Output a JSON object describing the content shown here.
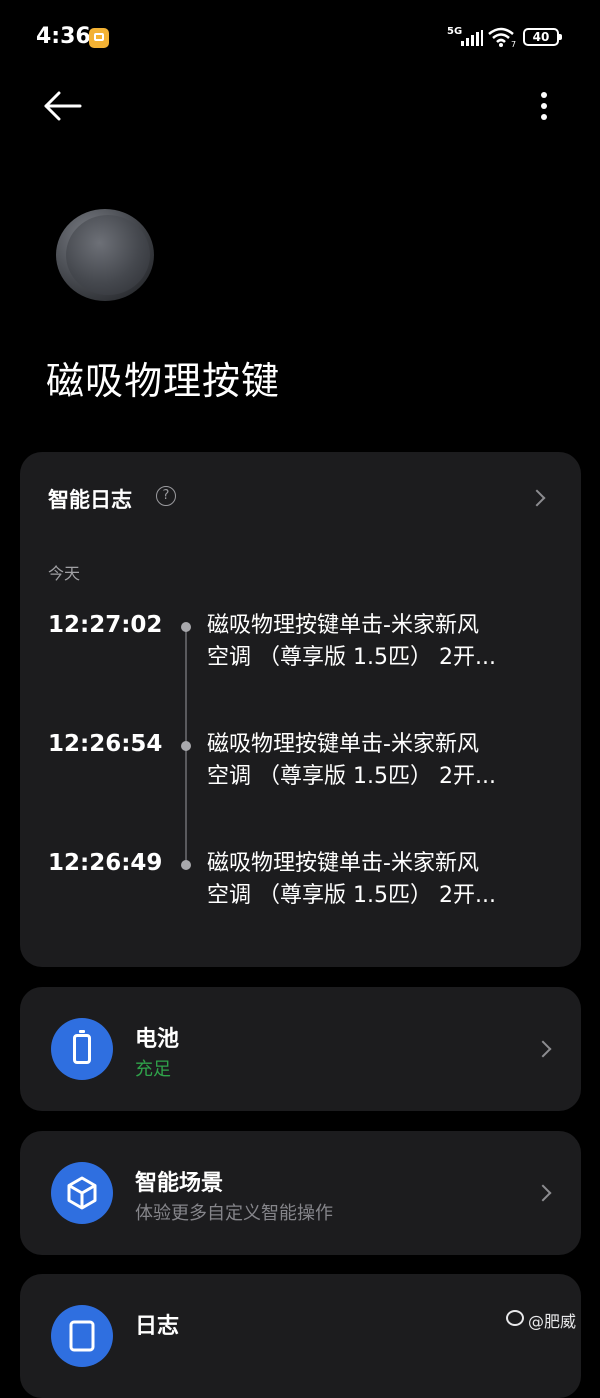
{
  "status_bar": {
    "time": "4:36",
    "network": "5G",
    "wifi_badge": "7",
    "battery": "40"
  },
  "header": {
    "back_icon": "arrow-left-icon",
    "more_icon": "more-vertical-icon"
  },
  "device": {
    "image": "magnetic-button-image",
    "title": "磁吸物理按键"
  },
  "smart_log": {
    "title": "智能日志",
    "help_icon": "?",
    "day_label": "今天",
    "entries": [
      {
        "time": "12:27:02",
        "line1": "磁吸物理按键单击-米家新风",
        "line2": "空调 （尊享版 1.5匹） 2开..."
      },
      {
        "time": "12:26:54",
        "line1": "磁吸物理按键单击-米家新风",
        "line2": "空调 （尊享版 1.5匹） 2开..."
      },
      {
        "time": "12:26:49",
        "line1": "磁吸物理按键单击-米家新风",
        "line2": "空调 （尊享版 1.5匹） 2开..."
      }
    ]
  },
  "rows": [
    {
      "title": "电池",
      "subtitle": "充足",
      "icon": "battery-icon",
      "subtitle_color": "#2fa24a"
    },
    {
      "title": "智能场景",
      "subtitle": "体验更多自定义智能操作",
      "icon": "cube-icon"
    },
    {
      "title": "日志",
      "icon": "log-icon"
    }
  ],
  "watermark": "@肥威",
  "colors": {
    "background": "#000000",
    "card": "#1c1c1e",
    "accent": "#2f6fe0",
    "success": "#2fa24a"
  }
}
